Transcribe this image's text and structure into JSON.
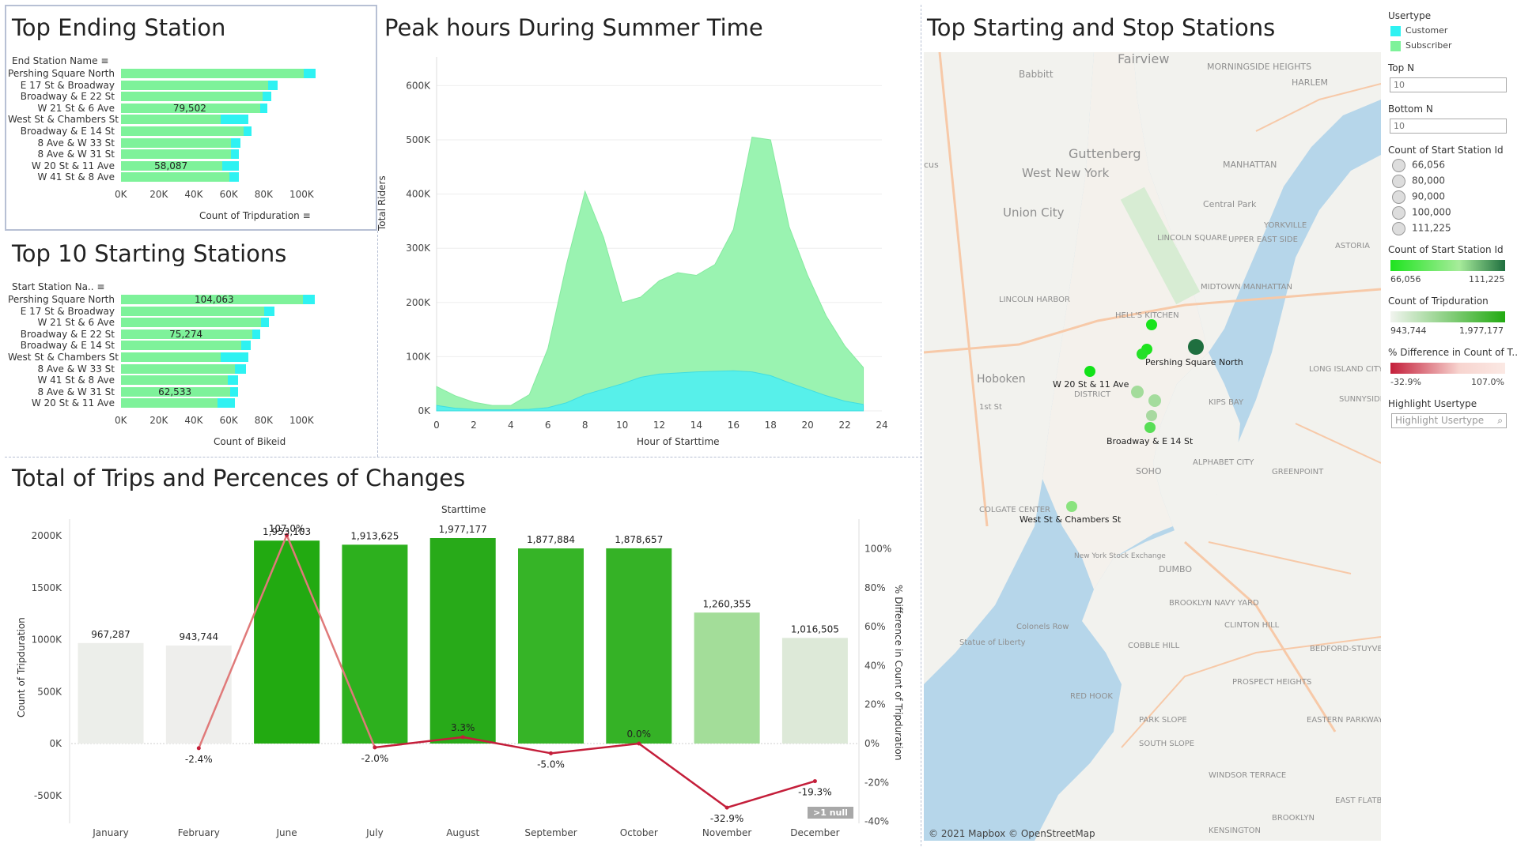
{
  "colors": {
    "subscriber": "#7ef29a",
    "customer": "#2ef2f2",
    "accent_dark": "#1f6f3f",
    "red": "#c41e3a"
  },
  "top_ending": {
    "title": "Top Ending Station",
    "field_label": "End Station Name",
    "axis_title": "Count of Tripduration",
    "ticks": [
      "0K",
      "20K",
      "40K",
      "60K",
      "80K",
      "100K"
    ],
    "rows": [
      {
        "name": "Pershing Square North",
        "subscriber": 104500,
        "customer": 7000,
        "label": ""
      },
      {
        "name": "E 17 St & Broadway",
        "subscriber": 84000,
        "customer": 5500,
        "label": ""
      },
      {
        "name": "Broadway & E 22 St",
        "subscriber": 81000,
        "customer": 5000,
        "label": ""
      },
      {
        "name": "W 21 St & 6 Ave",
        "subscriber": 79502,
        "customer": 4000,
        "label": "79,502"
      },
      {
        "name": "West St & Chambers St",
        "subscriber": 57000,
        "customer": 16000,
        "label": ""
      },
      {
        "name": "Broadway & E 14 St",
        "subscriber": 70000,
        "customer": 4500,
        "label": ""
      },
      {
        "name": "8 Ave & W 33 St",
        "subscriber": 63000,
        "customer": 5500,
        "label": ""
      },
      {
        "name": "8 Ave & W 31 St",
        "subscriber": 63000,
        "customer": 4500,
        "label": ""
      },
      {
        "name": "W 20 St & 11 Ave",
        "subscriber": 58087,
        "customer": 9500,
        "label": "58,087"
      },
      {
        "name": "W 41 St & 8 Ave",
        "subscriber": 62000,
        "customer": 5500,
        "label": ""
      }
    ]
  },
  "top_starting": {
    "title": "Top 10 Starting Stations",
    "field_label": "Start Station Na..",
    "axis_title": "Count of Bikeid",
    "ticks": [
      "0K",
      "20K",
      "40K",
      "60K",
      "80K",
      "100K"
    ],
    "rows": [
      {
        "name": "Pershing Square North",
        "subscriber": 104063,
        "customer": 7000,
        "label": "104,063"
      },
      {
        "name": "E 17 St & Broadway",
        "subscriber": 82000,
        "customer": 6000,
        "label": ""
      },
      {
        "name": "W 21 St & 6 Ave",
        "subscriber": 80000,
        "customer": 4500,
        "label": ""
      },
      {
        "name": "Broadway & E 22 St",
        "subscriber": 75274,
        "customer": 4500,
        "label": "75,274"
      },
      {
        "name": "Broadway & E 14 St",
        "subscriber": 69000,
        "customer": 5000,
        "label": ""
      },
      {
        "name": "West St & Chambers St",
        "subscriber": 57000,
        "customer": 16000,
        "label": ""
      },
      {
        "name": "8 Ave & W 33 St",
        "subscriber": 65000,
        "customer": 6500,
        "label": ""
      },
      {
        "name": "W 41 St & 8 Ave",
        "subscriber": 61000,
        "customer": 6000,
        "label": ""
      },
      {
        "name": "8 Ave & W 31 St",
        "subscriber": 62533,
        "customer": 4500,
        "label": "62,533"
      },
      {
        "name": "W 20 St & 11 Ave",
        "subscriber": 55000,
        "customer": 10000,
        "label": ""
      }
    ]
  },
  "peak": {
    "title": "Peak hours During Summer Time",
    "xlabel": "Hour of Starttime",
    "ylabel": "Total Riders",
    "yticks": [
      "0K",
      "100K",
      "200K",
      "300K",
      "400K",
      "500K",
      "600K"
    ],
    "xticks": [
      "0",
      "2",
      "4",
      "6",
      "8",
      "10",
      "12",
      "14",
      "16",
      "18",
      "20",
      "22",
      "24"
    ]
  },
  "chart_data": [
    {
      "type": "area",
      "title": "Peak hours During Summer Time",
      "xlabel": "Hour of Starttime",
      "ylabel": "Total Riders",
      "xlim": [
        0,
        24
      ],
      "ylim": [
        0,
        640000
      ],
      "x": [
        0,
        1,
        2,
        3,
        4,
        5,
        6,
        7,
        8,
        9,
        10,
        11,
        12,
        13,
        14,
        15,
        16,
        17,
        18,
        19,
        20,
        21,
        22,
        23
      ],
      "series": [
        {
          "name": "Customer",
          "values": [
            10000,
            5000,
            3000,
            2000,
            2000,
            3000,
            6000,
            15000,
            30000,
            40000,
            50000,
            62000,
            68000,
            70000,
            72000,
            73000,
            74000,
            72000,
            65000,
            52000,
            40000,
            28000,
            18000,
            12000
          ]
        },
        {
          "name": "Subscriber",
          "values": [
            45000,
            28000,
            16000,
            10000,
            10000,
            30000,
            115000,
            270000,
            405000,
            320000,
            200000,
            210000,
            240000,
            255000,
            250000,
            270000,
            335000,
            505000,
            500000,
            340000,
            250000,
            175000,
            120000,
            80000
          ]
        }
      ]
    },
    {
      "type": "bar",
      "title": "Total of Trips and Percences of Changes",
      "categories": [
        "January",
        "February",
        "June",
        "July",
        "August",
        "September",
        "October",
        "November",
        "December"
      ],
      "values": [
        967287,
        943744,
        1953103,
        1913625,
        1977177,
        1877884,
        1878657,
        1260355,
        1016505
      ],
      "ylabel": "Count of Tripduration",
      "ylim": [
        -700000,
        2100000
      ],
      "line": {
        "name": "% Difference in Count of Tripduration",
        "values": [
          null,
          -2.4,
          107.0,
          -2.0,
          3.3,
          -5.0,
          0.0,
          -32.9,
          -19.3
        ]
      },
      "y2lim": [
        -40,
        110
      ]
    }
  ],
  "trips": {
    "title": "Total of Trips and Percences of Changes",
    "col_header": "Starttime",
    "ylabel": "Count of Tripduration",
    "y2label": "% Difference in Count of Tripduration",
    "yticks": [
      "2000K",
      "1500K",
      "1000K",
      "500K",
      "0K",
      "-500K"
    ],
    "y2ticks": [
      "100%",
      "80%",
      "60%",
      "40%",
      "20%",
      "0%",
      "-20%",
      "-40%"
    ],
    "bar_labels": [
      "967,287",
      "943,744",
      "1,953,103",
      "1,913,625",
      "1,977,177",
      "1,877,884",
      "1,878,657",
      "1,260,355",
      "1,016,505"
    ],
    "pct_labels": [
      "",
      "-2.4%",
      "107.0%",
      "-2.0%",
      "3.3%",
      "-5.0%",
      "0.0%",
      "-32.9%",
      "-19.3%"
    ],
    "bar_colors": [
      "#eceeea",
      "#eeeeec",
      "#22aa11",
      "#2db01e",
      "#28aa19",
      "#36b427",
      "#35b226",
      "#a3dd99",
      "#dde9d8"
    ],
    "null_badge": ">1 null"
  },
  "map": {
    "title": "Top Starting and Stop Stations",
    "attribution": "© 2021 Mapbox © OpenStreetMap",
    "places": [
      "Fairview",
      "Babbitt",
      "MORNINGSIDE HEIGHTS",
      "HARLEM",
      "Guttenberg",
      "West New York",
      "Union City",
      "MANHATTAN",
      "Central Park",
      "YORKVILLE",
      "LINCOLN SQUARE",
      "UPPER EAST SIDE",
      "LINCOLN HARBOR",
      "HELL'S KITCHEN",
      "MIDTOWN MANHATTAN",
      "Hoboken",
      "DISTRICT",
      "KIPS BAY",
      "ASTORIA",
      "LONG ISLAND CITY",
      "SUNNYSIDE",
      "SOHO",
      "ALPHABET CITY",
      "GREENPOINT",
      "COLGATE CENTER",
      "New York Stock Exchange",
      "DUMBO",
      "BROOKLYN NAVY YARD",
      "Colonels Row",
      "Statue of Liberty",
      "COBBLE HILL",
      "CLINTON HILL",
      "BEDFORD-STUYVESANT",
      "RED HOOK",
      "PROSPECT HEIGHTS",
      "PARK SLOPE",
      "EASTERN PARKWAY",
      "SOUTH SLOPE",
      "WINDSOR TERRACE",
      "EAST FLATBUSH",
      "BROOKLYN",
      "KENSINGTON",
      "1st St",
      "cus"
    ],
    "station_labels": [
      "Pershing Square North",
      "W 20 St & 11 Ave",
      "Broadway & E 14 St",
      "West St & Chambers St"
    ]
  },
  "legend": {
    "usertype_title": "Usertype",
    "usertypes": [
      "Customer",
      "Subscriber"
    ],
    "topn_title": "Top N",
    "topn_value": "10",
    "bottomn_title": "Bottom N",
    "bottomn_value": "10",
    "size_title": "Count of Start Station Id",
    "size_values": [
      "66,056",
      "80,000",
      "90,000",
      "100,000",
      "111,225"
    ],
    "color_title": "Count of Start Station Id",
    "color_min": "66,056",
    "color_max": "111,225",
    "trip_title": "Count of Tripduration",
    "trip_min": "943,744",
    "trip_max": "1,977,177",
    "diff_title": "% Difference in Count of T..",
    "diff_min": "-32.9%",
    "diff_max": "107.0%",
    "highlight_title": "Highlight Usertype",
    "highlight_placeholder": "Highlight Usertype"
  }
}
